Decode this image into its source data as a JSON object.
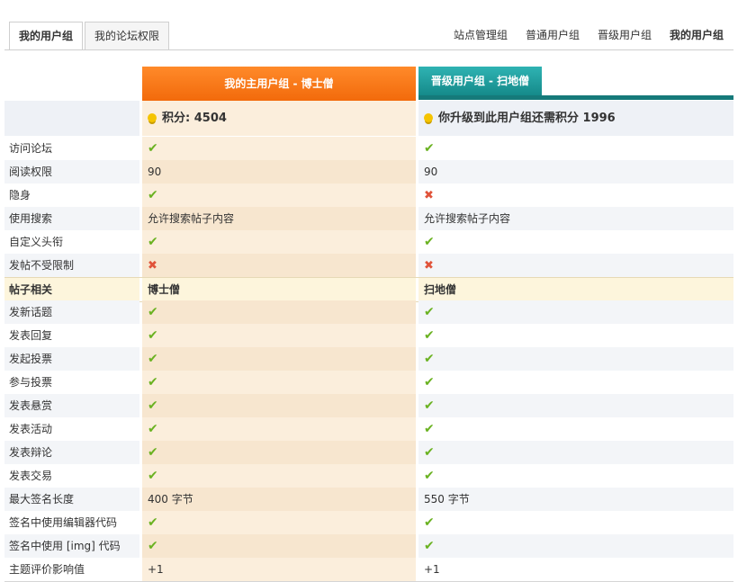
{
  "tabs": {
    "my_group": "我的用户组",
    "forum_perms": "我的论坛权限"
  },
  "nav": [
    "站点管理组",
    "普通用户组",
    "晋级用户组",
    "我的用户组"
  ],
  "groups": {
    "main": "我的主用户组 - 博士僧",
    "next": "晋级用户组 - 扫地僧"
  },
  "points": {
    "main": "积分: 4504",
    "next": "你升级到此用户组还需积分 1996"
  },
  "rows": [
    {
      "label": "访问论坛",
      "main": "✔",
      "next": "✔",
      "main_ok": true,
      "next_ok": true
    },
    {
      "label": "阅读权限",
      "main": "90",
      "next": "90"
    },
    {
      "label": "隐身",
      "main": "✔",
      "next": "✖",
      "main_ok": true,
      "next_ok": false
    },
    {
      "label": "使用搜索",
      "main": "允许搜索帖子内容",
      "next": "允许搜索帖子内容"
    },
    {
      "label": "自定义头衔",
      "main": "✔",
      "next": "✔",
      "main_ok": true,
      "next_ok": true
    },
    {
      "label": "发帖不受限制",
      "main": "✖",
      "next": "✖",
      "main_ok": false,
      "next_ok": false
    },
    {
      "label": "帖子相关",
      "main": "博士僧",
      "next": "扫地僧",
      "section": true
    },
    {
      "label": "发新话题",
      "main": "✔",
      "next": "✔",
      "main_ok": true,
      "next_ok": true
    },
    {
      "label": "发表回复",
      "main": "✔",
      "next": "✔",
      "main_ok": true,
      "next_ok": true
    },
    {
      "label": "发起投票",
      "main": "✔",
      "next": "✔",
      "main_ok": true,
      "next_ok": true
    },
    {
      "label": "参与投票",
      "main": "✔",
      "next": "✔",
      "main_ok": true,
      "next_ok": true
    },
    {
      "label": "发表悬赏",
      "main": "✔",
      "next": "✔",
      "main_ok": true,
      "next_ok": true
    },
    {
      "label": "发表活动",
      "main": "✔",
      "next": "✔",
      "main_ok": true,
      "next_ok": true
    },
    {
      "label": "发表辩论",
      "main": "✔",
      "next": "✔",
      "main_ok": true,
      "next_ok": true
    },
    {
      "label": "发表交易",
      "main": "✔",
      "next": "✔",
      "main_ok": true,
      "next_ok": true
    },
    {
      "label": "最大签名长度",
      "main": "400 字节",
      "next": "550 字节"
    },
    {
      "label": "签名中使用编辑器代码",
      "main": "✔",
      "next": "✔",
      "main_ok": true,
      "next_ok": true
    },
    {
      "label": "签名中使用 [img] 代码",
      "main": "✔",
      "next": "✔",
      "main_ok": true,
      "next_ok": true
    },
    {
      "label": "主题评价影响值",
      "main": "+1",
      "next": "+1"
    }
  ]
}
